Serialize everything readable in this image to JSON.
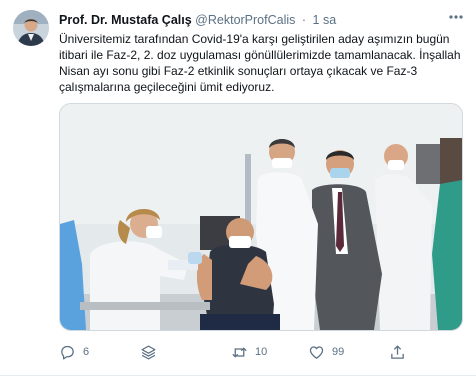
{
  "tweet": {
    "author_name": "Prof. Dr. Mustafa Çalış",
    "handle": "@RektorProfCalis",
    "separator": "·",
    "time": "1 sa",
    "text": "Üniversitemiz tarafından Covid-19'a karşı geliştirilen aday aşımızın bugün itibari ile Faz-2, 2. doz uygulaması gönüllülerimizde tamamlanacak. İnşallah Nisan ayı sonu gibi Faz-2 etkinlik sonuçları ortaya çıkacak ve Faz-3 çalışmalarına geçileceğini ümit ediyoruz."
  },
  "actions": {
    "replies": "6",
    "retweets": "10",
    "likes": "99"
  },
  "icons": {
    "more": "more-icon",
    "reply": "reply-icon",
    "stack": "layers-icon",
    "retweet": "retweet-icon",
    "like": "heart-icon",
    "share": "share-icon"
  },
  "colors": {
    "text_primary": "#0f1419",
    "text_secondary": "#5b7083",
    "border": "#cfd9de",
    "background": "#ffffff"
  }
}
